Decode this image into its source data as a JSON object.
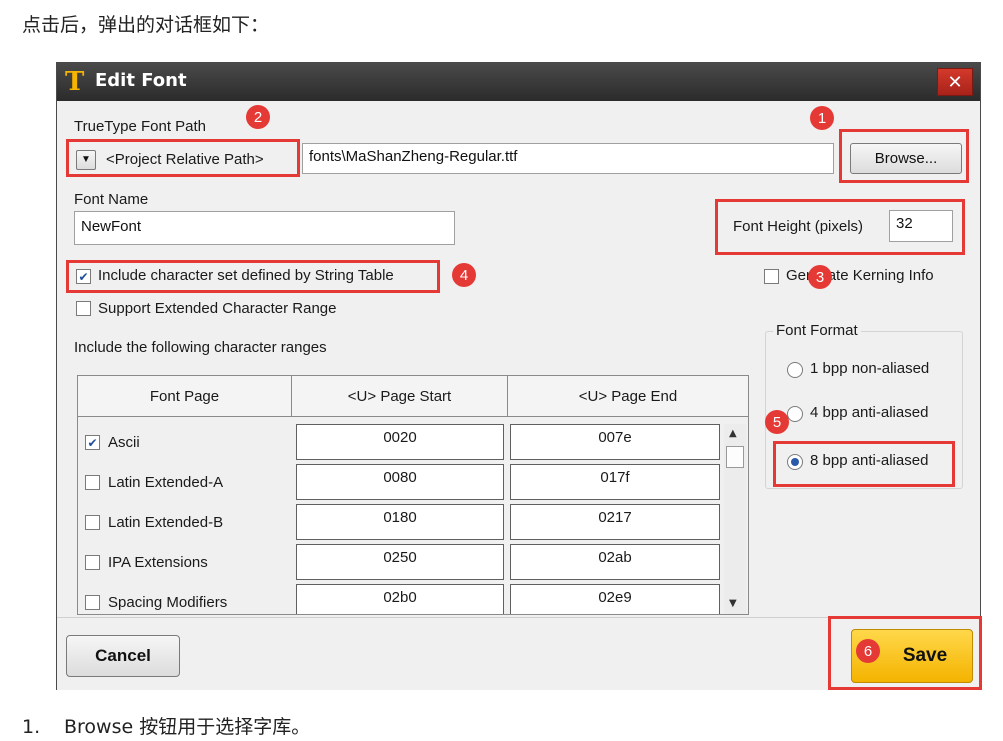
{
  "intro_text": "点击后，弹出的对话框如下：",
  "footer": {
    "number": "1.",
    "text": "Browse 按钮用于选择字库。"
  },
  "dialog": {
    "title": "Edit Font",
    "title_icon": "T",
    "close_icon": "✕",
    "font_path": {
      "label": "TrueType Font Path",
      "path_mode": "<Project Relative Path>",
      "value": "fonts\\MaShanZheng-Regular.ttf",
      "browse_label": "Browse..."
    },
    "font_name": {
      "label": "Font Name",
      "value": "NewFont"
    },
    "font_height": {
      "label": "Font Height (pixels)",
      "value": "32"
    },
    "kerning": {
      "label": "Generate Kerning Info",
      "checked": false
    },
    "include_string_table": {
      "label": "Include character set defined by String Table",
      "checked": true
    },
    "extended_range": {
      "label": "Support Extended Character Range",
      "checked": false
    },
    "ranges_label": "Include the following character ranges",
    "table": {
      "headers": [
        "Font Page",
        "<U> Page Start",
        "<U> Page End"
      ],
      "rows": [
        {
          "name": "Ascii",
          "checked": true,
          "start": "0020",
          "end": "007e"
        },
        {
          "name": "Latin Extended-A",
          "checked": false,
          "start": "0080",
          "end": "017f"
        },
        {
          "name": "Latin Extended-B",
          "checked": false,
          "start": "0180",
          "end": "0217"
        },
        {
          "name": "IPA Extensions",
          "checked": false,
          "start": "0250",
          "end": "02ab"
        },
        {
          "name": "Spacing Modifiers",
          "checked": false,
          "start": "02b0",
          "end": "02e9"
        }
      ]
    },
    "font_format": {
      "label": "Font Format",
      "options": [
        "1 bpp non-aliased",
        "4 bpp anti-aliased",
        "8 bpp anti-aliased"
      ],
      "selected": "8 bpp anti-aliased"
    },
    "cancel_label": "Cancel",
    "save_label": "Save"
  },
  "annotations": [
    "1",
    "2",
    "3",
    "4",
    "5",
    "6"
  ],
  "colors": {
    "annotation_red": "#e53935",
    "save_yellow": "#f4b300",
    "title_bar": "#2b2b2b"
  }
}
